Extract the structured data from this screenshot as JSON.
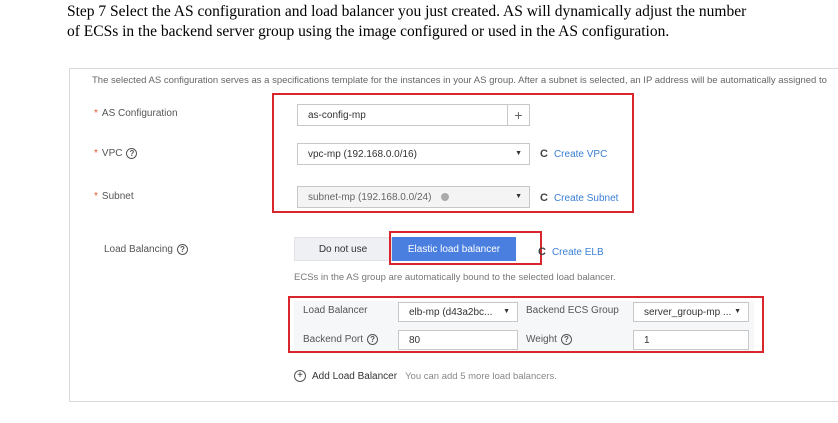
{
  "step_text": "Step 7 Select the AS configuration and load balancer you just created. AS will dynamically adjust the number of ECSs in the backend server group using the image configured or used in the AS configuration.",
  "info_text": "The selected AS configuration serves as a specifications template for the instances in your AS group. After a subnet is selected, an IP address will be automatically assigned to",
  "form": {
    "as_config": {
      "label": "AS Configuration",
      "value": "as-config-mp",
      "add_symbol": "+"
    },
    "vpc": {
      "label": "VPC",
      "value": "vpc-mp (192.168.0.0/16)",
      "link": "Create VPC"
    },
    "subnet": {
      "label": "Subnet",
      "value": "subnet-mp (192.168.0.0/24)",
      "link": "Create Subnet"
    },
    "required_mark": "*",
    "help_symbol": "?",
    "caret_symbol": "▼",
    "refresh_symbol": "C"
  },
  "load_balancing": {
    "label": "Load Balancing",
    "options": [
      "Do not use",
      "Elastic load balancer"
    ],
    "selected": "Elastic load balancer",
    "create_link": "Create ELB",
    "note": "ECSs in the AS group are automatically bound to the selected load balancer.",
    "table": {
      "lb_label": "Load Balancer",
      "lb_value": "elb-mp (d43a2bc...",
      "group_label": "Backend ECS Group",
      "group_value": "server_group-mp ...",
      "port_label": "Backend Port",
      "port_value": "80",
      "weight_label": "Weight",
      "weight_value": "1"
    },
    "add_label": "Add Load Balancer",
    "add_hint": "You can add 5 more load balancers."
  },
  "colors": {
    "accent": "#4a7fe0",
    "link": "#3a7fd5",
    "highlight": "#d9262c",
    "required": "#e05a2c"
  }
}
